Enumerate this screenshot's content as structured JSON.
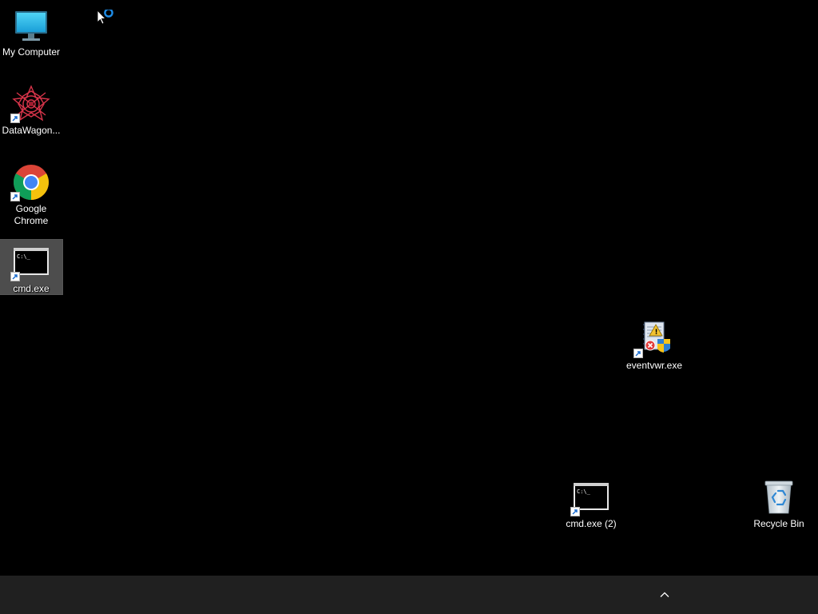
{
  "desktop": {
    "icons": [
      {
        "label": "My Computer",
        "icon": "monitor-icon",
        "shortcut": false,
        "selected": false
      },
      {
        "label": "DataWagon...",
        "icon": "datawagon-icon",
        "shortcut": true,
        "selected": false
      },
      {
        "label": "Google Chrome",
        "icon": "chrome-icon",
        "shortcut": true,
        "selected": false
      },
      {
        "label": "cmd.exe",
        "icon": "cmd-icon",
        "shortcut": true,
        "selected": true
      },
      {
        "label": "eventvwr.exe",
        "icon": "event-viewer-icon",
        "shortcut": true,
        "selected": false
      },
      {
        "label": "cmd.exe (2)",
        "icon": "cmd-icon",
        "shortcut": true,
        "selected": false
      },
      {
        "label": "Recycle Bin",
        "icon": "recycle-bin-icon",
        "shortcut": false,
        "selected": false
      }
    ]
  },
  "taskbar": {
    "tray_chevron": "chevron-up-icon"
  },
  "cursor": "busy-arrow-cursor",
  "colors": {
    "desktop_bg": "#000000",
    "taskbar_bg": "#202020",
    "selection": "#7f7f7f"
  }
}
